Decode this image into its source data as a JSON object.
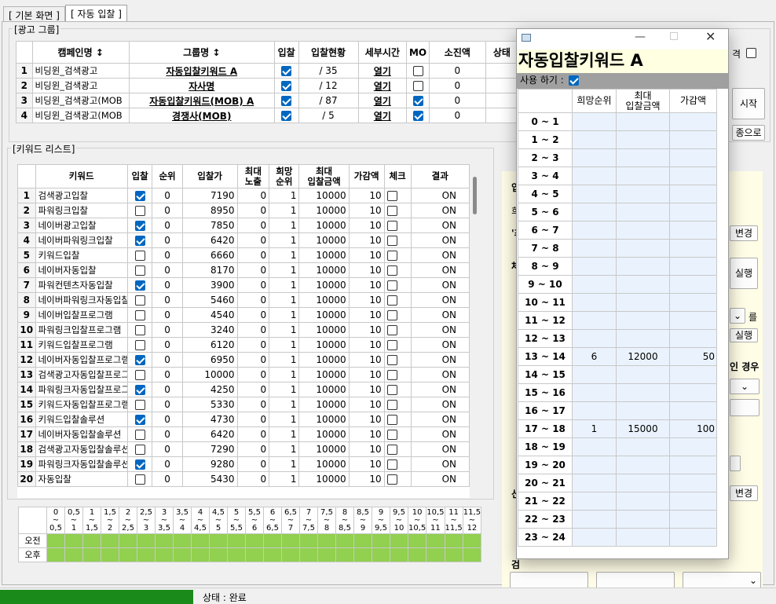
{
  "tabs": [
    "[ 기본 화면 ]",
    "[ 자동 입찰 ]"
  ],
  "ad_group": {
    "title": "[광고 그룹]",
    "headers": [
      "캠페인명 ↕",
      "그룹명 ↕",
      "입찰",
      "입찰현황",
      "세부시간",
      "MO",
      "소진액",
      "상태"
    ],
    "rows": [
      {
        "n": "1",
        "campaign": "비딩윈_검색광고",
        "group": "자동입찰키워드 A",
        "bid": true,
        "status": "/ 35",
        "detail": "열기",
        "mo": false,
        "spent": "0"
      },
      {
        "n": "2",
        "campaign": "비딩윈_검색광고",
        "group": "자사명",
        "bid": true,
        "status": "/ 12",
        "detail": "열기",
        "mo": false,
        "spent": "0"
      },
      {
        "n": "3",
        "campaign": "비딩윈_검색광고(MOB",
        "group": "자동입찰키워드(MOB) A",
        "bid": true,
        "status": "/ 87",
        "detail": "열기",
        "mo": true,
        "spent": "0"
      },
      {
        "n": "4",
        "campaign": "비딩윈_검색광고(MOB",
        "group": "경쟁사(MOB)",
        "bid": true,
        "status": "/ 5",
        "detail": "열기",
        "mo": true,
        "spent": "0"
      }
    ]
  },
  "keyword_list": {
    "title": "[키워드 리스트]",
    "headers": [
      "키워드",
      "입찰",
      "순위",
      "입찰가",
      "최대\n노출",
      "희망\n순위",
      "최대\n입찰금액",
      "가감액",
      "체크",
      "결과"
    ],
    "rows": [
      {
        "n": "1",
        "kw": "검색광고입찰",
        "bid": true,
        "rank": "0",
        "price": "7190",
        "max": "0",
        "hope": "1",
        "maxbid": "10000",
        "adj": "10",
        "result": "ON"
      },
      {
        "n": "2",
        "kw": "파워링크입찰",
        "bid": false,
        "rank": "0",
        "price": "8950",
        "max": "0",
        "hope": "1",
        "maxbid": "10000",
        "adj": "10",
        "result": "ON"
      },
      {
        "n": "3",
        "kw": "네이버광고입찰",
        "bid": true,
        "rank": "0",
        "price": "7850",
        "max": "0",
        "hope": "1",
        "maxbid": "10000",
        "adj": "10",
        "result": "ON"
      },
      {
        "n": "4",
        "kw": "네이버파워링크입찰",
        "bid": true,
        "rank": "0",
        "price": "6420",
        "max": "0",
        "hope": "1",
        "maxbid": "10000",
        "adj": "10",
        "result": "ON"
      },
      {
        "n": "5",
        "kw": "키워드입찰",
        "bid": false,
        "rank": "0",
        "price": "6660",
        "max": "0",
        "hope": "1",
        "maxbid": "10000",
        "adj": "10",
        "result": "ON"
      },
      {
        "n": "6",
        "kw": "네이버자동입찰",
        "bid": false,
        "rank": "0",
        "price": "8170",
        "max": "0",
        "hope": "1",
        "maxbid": "10000",
        "adj": "10",
        "result": "ON"
      },
      {
        "n": "7",
        "kw": "파워컨텐츠자동입찰",
        "bid": true,
        "rank": "0",
        "price": "3900",
        "max": "0",
        "hope": "1",
        "maxbid": "10000",
        "adj": "10",
        "result": "ON"
      },
      {
        "n": "8",
        "kw": "네이버파워링크자동입찰",
        "bid": false,
        "rank": "0",
        "price": "5460",
        "max": "0",
        "hope": "1",
        "maxbid": "10000",
        "adj": "10",
        "result": "ON"
      },
      {
        "n": "9",
        "kw": "네이버입찰프로그램",
        "bid": false,
        "rank": "0",
        "price": "4540",
        "max": "0",
        "hope": "1",
        "maxbid": "10000",
        "adj": "10",
        "result": "ON"
      },
      {
        "n": "10",
        "kw": "파워링크입찰프로그램",
        "bid": false,
        "rank": "0",
        "price": "3240",
        "max": "0",
        "hope": "1",
        "maxbid": "10000",
        "adj": "10",
        "result": "ON"
      },
      {
        "n": "11",
        "kw": "키워드입찰프로그램",
        "bid": false,
        "rank": "0",
        "price": "6120",
        "max": "0",
        "hope": "1",
        "maxbid": "10000",
        "adj": "10",
        "result": "ON"
      },
      {
        "n": "12",
        "kw": "네이버자동입찰프로그램",
        "bid": true,
        "rank": "0",
        "price": "6950",
        "max": "0",
        "hope": "1",
        "maxbid": "10000",
        "adj": "10",
        "result": "ON"
      },
      {
        "n": "13",
        "kw": "검색광고자동입찰프로그램",
        "bid": false,
        "rank": "0",
        "price": "10000",
        "max": "0",
        "hope": "1",
        "maxbid": "10000",
        "adj": "10",
        "result": "ON"
      },
      {
        "n": "14",
        "kw": "파워링크자동입찰프로그램",
        "bid": true,
        "rank": "0",
        "price": "4250",
        "max": "0",
        "hope": "1",
        "maxbid": "10000",
        "adj": "10",
        "result": "ON"
      },
      {
        "n": "15",
        "kw": "키워드자동입찰프로그램",
        "bid": false,
        "rank": "0",
        "price": "5330",
        "max": "0",
        "hope": "1",
        "maxbid": "10000",
        "adj": "10",
        "result": "ON"
      },
      {
        "n": "16",
        "kw": "키워드입찰솔루션",
        "bid": true,
        "rank": "0",
        "price": "4730",
        "max": "0",
        "hope": "1",
        "maxbid": "10000",
        "adj": "10",
        "result": "ON"
      },
      {
        "n": "17",
        "kw": "네이버자동입찰솔루션",
        "bid": false,
        "rank": "0",
        "price": "6420",
        "max": "0",
        "hope": "1",
        "maxbid": "10000",
        "adj": "10",
        "result": "ON"
      },
      {
        "n": "18",
        "kw": "검색광고자동입찰솔루션",
        "bid": false,
        "rank": "0",
        "price": "7290",
        "max": "0",
        "hope": "1",
        "maxbid": "10000",
        "adj": "10",
        "result": "ON"
      },
      {
        "n": "19",
        "kw": "파워링크자동입찰솔루션",
        "bid": true,
        "rank": "0",
        "price": "9280",
        "max": "0",
        "hope": "1",
        "maxbid": "10000",
        "adj": "10",
        "result": "ON"
      },
      {
        "n": "20",
        "kw": "자동입찰",
        "bid": false,
        "rank": "0",
        "price": "5430",
        "max": "0",
        "hope": "1",
        "maxbid": "10000",
        "adj": "10",
        "result": "ON"
      }
    ]
  },
  "schedule": {
    "slots": [
      "0\n~\n0,5",
      "0,5\n~\n1",
      "1\n~\n1,5",
      "1,5\n~\n2",
      "2\n~\n2,5",
      "2,5\n~\n3",
      "3\n~\n3,5",
      "3,5\n~\n4",
      "4\n~\n4,5",
      "4,5\n~\n5",
      "5\n~\n5,5",
      "5,5\n~\n6",
      "6\n~\n6,5",
      "6,5\n~\n7",
      "7\n~\n7,5",
      "7,5\n~\n8",
      "8\n~\n8,5",
      "8,5\n~\n9",
      "9\n~\n9,5",
      "9,5\n~\n10",
      "10\n~\n10,5",
      "10,5\n~\n11",
      "11\n~\n11,5",
      "11,5\n~\n12"
    ],
    "rows": [
      "오전",
      "오후"
    ]
  },
  "right_panel": {
    "labels": [
      "입",
      "희",
      "'최",
      "체",
      "선",
      "검"
    ],
    "partial_texts": [
      "격",
      "시작",
      "종으로",
      "'최",
      "변경",
      "실행",
      "를",
      "실행",
      "인 경우",
      "변경"
    ]
  },
  "status": {
    "text": "상태 : 완료",
    "progress_color": "#1a8a1a"
  },
  "popup": {
    "title": "자동입찰키워드 A",
    "use_label": "사용 하기 :",
    "use_checked": true,
    "headers": [
      "희망순위",
      "최대\n입찰금액",
      "가감액"
    ],
    "rows": [
      {
        "label": "0 ~ 1",
        "rank": "",
        "max": "",
        "adj": ""
      },
      {
        "label": "1 ~ 2",
        "rank": "",
        "max": "",
        "adj": ""
      },
      {
        "label": "2 ~ 3",
        "rank": "",
        "max": "",
        "adj": ""
      },
      {
        "label": "3 ~ 4",
        "rank": "",
        "max": "",
        "adj": ""
      },
      {
        "label": "4 ~ 5",
        "rank": "",
        "max": "",
        "adj": ""
      },
      {
        "label": "5 ~ 6",
        "rank": "",
        "max": "",
        "adj": ""
      },
      {
        "label": "6 ~ 7",
        "rank": "",
        "max": "",
        "adj": ""
      },
      {
        "label": "7 ~ 8",
        "rank": "",
        "max": "",
        "adj": ""
      },
      {
        "label": "8 ~ 9",
        "rank": "",
        "max": "",
        "adj": ""
      },
      {
        "label": "9 ~ 10",
        "rank": "",
        "max": "",
        "adj": ""
      },
      {
        "label": "10 ~ 11",
        "rank": "",
        "max": "",
        "adj": ""
      },
      {
        "label": "11 ~ 12",
        "rank": "",
        "max": "",
        "adj": ""
      },
      {
        "label": "12 ~ 13",
        "rank": "",
        "max": "",
        "adj": ""
      },
      {
        "label": "13 ~ 14",
        "rank": "6",
        "max": "12000",
        "adj": "50"
      },
      {
        "label": "14 ~ 15",
        "rank": "",
        "max": "",
        "adj": ""
      },
      {
        "label": "15 ~ 16",
        "rank": "",
        "max": "",
        "adj": ""
      },
      {
        "label": "16 ~ 17",
        "rank": "",
        "max": "",
        "adj": ""
      },
      {
        "label": "17 ~ 18",
        "rank": "1",
        "max": "15000",
        "adj": "100"
      },
      {
        "label": "18 ~ 19",
        "rank": "",
        "max": "",
        "adj": ""
      },
      {
        "label": "19 ~ 20",
        "rank": "",
        "max": "",
        "adj": ""
      },
      {
        "label": "20 ~ 21",
        "rank": "",
        "max": "",
        "adj": ""
      },
      {
        "label": "21 ~ 22",
        "rank": "",
        "max": "",
        "adj": ""
      },
      {
        "label": "22 ~ 23",
        "rank": "",
        "max": "",
        "adj": ""
      },
      {
        "label": "23 ~ 24",
        "rank": "",
        "max": "",
        "adj": ""
      }
    ]
  }
}
